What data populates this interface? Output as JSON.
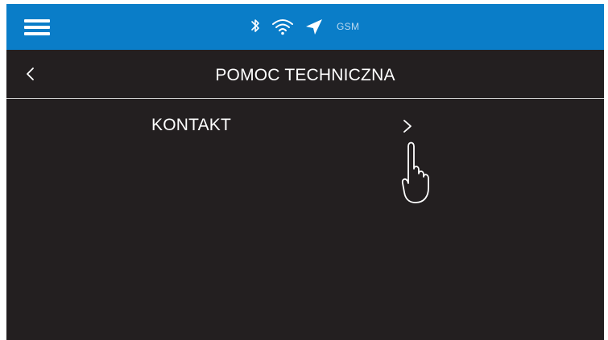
{
  "statusbar": {
    "icons": [
      "menu-icon",
      "bluetooth-icon",
      "wifi-icon",
      "location-arrow-icon"
    ],
    "network_label": "GSM",
    "background_color": "#0a7dc8"
  },
  "header": {
    "title": "POMOC TECHNICZNA",
    "back_icon": "chevron-left-icon"
  },
  "menu": {
    "items": [
      {
        "label": "KONTAKT",
        "icon": "chevron-right-icon"
      }
    ]
  },
  "overlay": {
    "icon": "pointing-hand-icon"
  },
  "colors": {
    "accent": "#0a7dc8",
    "background": "#231f20",
    "text": "#ffffff",
    "divider": "#cfcfcf"
  }
}
